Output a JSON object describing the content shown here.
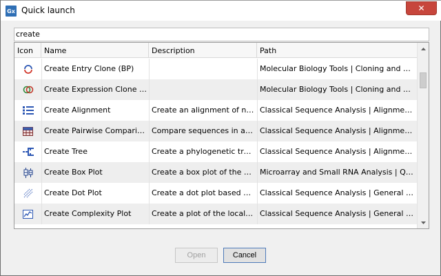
{
  "window": {
    "title": "Quick launch",
    "app_icon_text": "Gx"
  },
  "search": {
    "value": "create"
  },
  "table": {
    "columns": [
      "Icon",
      "Name",
      "Description",
      "Path"
    ],
    "rows": [
      {
        "icon": "entry-clone-icon",
        "name": "Create Entry Clone (BP)",
        "description": "",
        "path": "Molecular Biology Tools | Cloning and Restric…"
      },
      {
        "icon": "expression-clone-icon",
        "name": "Create Expression Clone (LR)",
        "description": "",
        "path": "Molecular Biology Tools | Cloning and Restric…"
      },
      {
        "icon": "alignment-icon",
        "name": "Create Alignment",
        "description": "Create an alignment of nucle…",
        "path": "Classical Sequence Analysis | Alignments an…"
      },
      {
        "icon": "pairwise-comparison-icon",
        "name": "Create Pairwise Comparison",
        "description": "Compare sequences in an ali…",
        "path": "Classical Sequence Analysis | Alignments an…"
      },
      {
        "icon": "tree-icon",
        "name": "Create Tree",
        "description": "Create a phylogenetic tree b…",
        "path": "Classical Sequence Analysis | Alignments an…"
      },
      {
        "icon": "box-plot-icon",
        "name": "Create Box Plot",
        "description": "Create a box plot of the valu…",
        "path": "Microarray and Small RNA Analysis | Quality …"
      },
      {
        "icon": "dot-plot-icon",
        "name": "Create Dot Plot",
        "description": "Create a dot plot based on o…",
        "path": "Classical Sequence Analysis | General Seque…"
      },
      {
        "icon": "complexity-plot-icon",
        "name": "Create Complexity Plot",
        "description": "Create a plot of the local co…",
        "path": "Classical Sequence Analysis | General Seque…"
      }
    ]
  },
  "buttons": {
    "open": "Open",
    "cancel": "Cancel"
  },
  "colors": {
    "accent": "#2f6fb5",
    "close": "#c7463c",
    "row_alt": "#eeeeee"
  }
}
